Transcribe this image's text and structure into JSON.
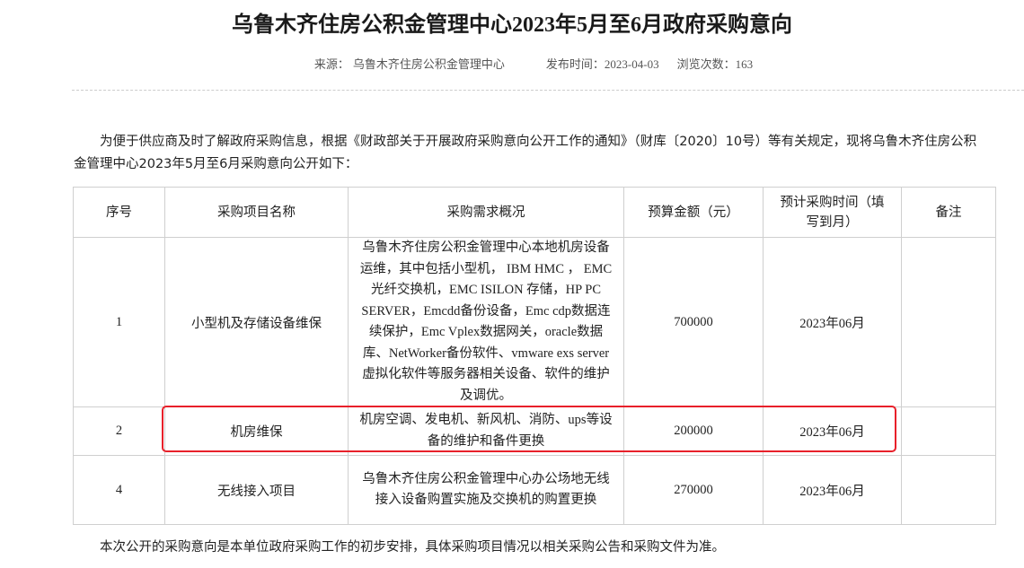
{
  "article": {
    "title": "乌鲁木齐住房公积金管理中心2023年5月至6月政府采购意向",
    "source_label": "来源：",
    "source_value": "乌鲁木齐住房公积金管理中心",
    "publish_label": "发布时间：",
    "publish_value": "2023-04-03",
    "views_label": "浏览次数：",
    "views_value": "163",
    "intro": "为便于供应商及时了解政府采购信息，根据《财政部关于开展政府采购意向公开工作的通知》（财库〔2020〕10号）等有关规定，现将乌鲁木齐住房公积金管理中心2023年5月至6月采购意向公开如下：",
    "footer": "本次公开的采购意向是本单位政府采购工作的初步安排，具体采购项目情况以相关采购公告和采购文件为准。"
  },
  "table": {
    "headers": [
      "序号",
      "采购项目名称",
      "采购需求概况",
      "预算金额（元）",
      "预计采购时间（填写到月）",
      "备注"
    ],
    "rows": [
      {
        "no": "1",
        "name": "小型机及存储设备维保",
        "desc": "乌鲁木齐住房公积金管理中心本地机房设备运维，其中包括小型机， IBM HMC ， EMC 光纤交换机，EMC ISILON 存储，HP PC SERVER，Emcdd备份设备，Emc cdp数据连续保护，Emc Vplex数据网关，oracle数据库、NetWorker备份软件、vmware exs server虚拟化软件等服务器相关设备、软件的维护及调优。",
        "budget": "700000",
        "time": "2023年06月",
        "note": ""
      },
      {
        "no": "2",
        "name": "机房维保",
        "desc": "机房空调、发电机、新风机、消防、ups等设备的维护和备件更换",
        "budget": "200000",
        "time": "2023年06月",
        "note": ""
      },
      {
        "no": "4",
        "name": "无线接入项目",
        "desc": "乌鲁木齐住房公积金管理中心办公场地无线接入设备购置实施及交换机的购置更换",
        "budget": "270000",
        "time": "2023年06月",
        "note": ""
      }
    ]
  },
  "colors": {
    "highlight_border": "#e8202a",
    "table_border": "#cfcfcf"
  }
}
